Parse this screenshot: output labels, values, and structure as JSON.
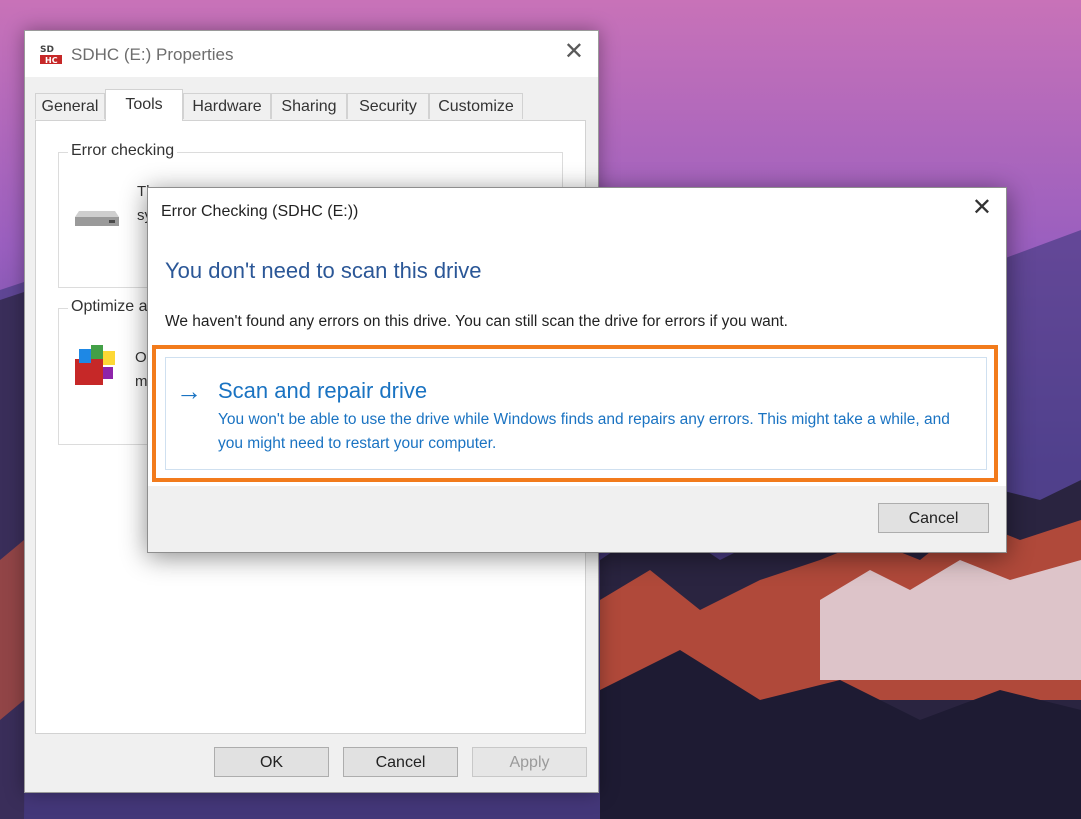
{
  "properties_window": {
    "title_icon_text": "SD HC",
    "title": "SDHC (E:) Properties",
    "close_glyph": "✕",
    "tabs": [
      {
        "label": "General"
      },
      {
        "label": "Tools"
      },
      {
        "label": "Hardware"
      },
      {
        "label": "Sharing"
      },
      {
        "label": "Security"
      },
      {
        "label": "Customize"
      }
    ],
    "active_tab": "Tools",
    "error_checking": {
      "label": "Error checking",
      "text_line1": "Th",
      "text_line2": "sy"
    },
    "optimize": {
      "label": "Optimize a",
      "text_line1": "O",
      "text_line2": "m"
    },
    "buttons": {
      "ok": "OK",
      "cancel": "Cancel",
      "apply": "Apply"
    }
  },
  "error_dialog": {
    "title": "Error Checking (SDHC (E:))",
    "close_glyph": "✕",
    "heading": "You don't need to scan this drive",
    "body": "We haven't found any errors on this drive. You can still scan the drive for errors if you want.",
    "option": {
      "arrow": "→",
      "title": "Scan and repair drive",
      "description": "You won't be able to use the drive while Windows finds and repairs any errors. This might take a while, and you might need to restart your computer."
    },
    "cancel_label": "Cancel",
    "highlight_color": "#f27b1c",
    "accent_color": "#1a73c2"
  }
}
